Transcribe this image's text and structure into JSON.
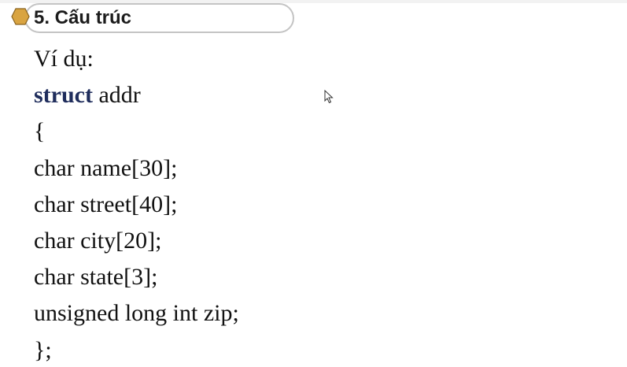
{
  "slide": {
    "title": "5. Cấu trúc",
    "intro": "Ví dụ:",
    "code": {
      "keyword": "struct",
      "struct_name": " addr",
      "open_brace": "{",
      "fields": [
        "char name[30];",
        "char street[40];",
        "char city[20];",
        "char state[3];",
        "unsigned long int zip;"
      ],
      "close": "};"
    }
  },
  "colors": {
    "keyword": "#1f2d5c",
    "bullet": "#d9a441",
    "header_border": "#c4c4c4"
  },
  "icons": {
    "bullet": "hexagon-bullet-icon",
    "cursor": "mouse-pointer-icon"
  }
}
